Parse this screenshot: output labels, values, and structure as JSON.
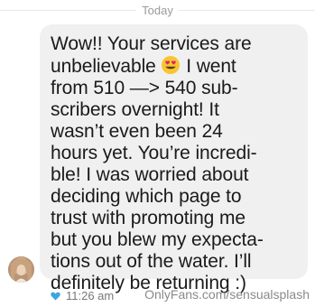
{
  "day_separator": "Today",
  "message": {
    "lines": [
      "Wow!! Your services are",
      "unbelievable",
      " I went",
      "from 510 —> 540 sub-",
      "scribers overnight! It",
      "wasn’t even been 24",
      "hours yet. You’re incredi-",
      "ble! I was worried about",
      "deciding which page to",
      "trust with promoting me",
      "but you blew my expecta-",
      "tions out of the water. I’ll",
      "definitely be returning :)"
    ],
    "emoji": "heart-eyes-emoji"
  },
  "meta": {
    "time": "11:26 am",
    "icon": "heart-icon"
  },
  "watermark": "OnlyFans.com/sensualsplash",
  "colors": {
    "bubble": "#f0f0f0",
    "heart": "#3aa6e0",
    "text": "#1a1a1a"
  }
}
